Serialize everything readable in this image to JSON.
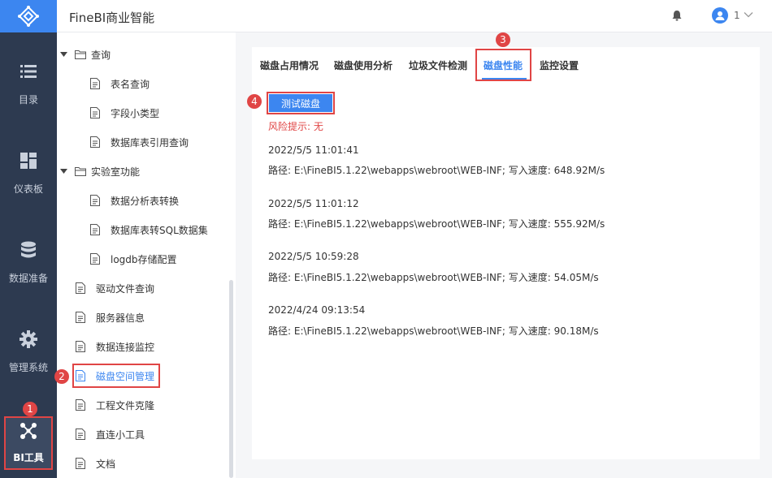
{
  "header": {
    "app_title": "FineBI商业智能",
    "user_name": "1"
  },
  "leftnav": {
    "items": [
      {
        "label": "目录",
        "icon": "list-icon"
      },
      {
        "label": "仪表板",
        "icon": "dashboard-icon"
      },
      {
        "label": "数据准备",
        "icon": "database-icon"
      },
      {
        "label": "管理系统",
        "icon": "gear-icon"
      },
      {
        "label": "BI工具",
        "icon": "bi-tools-icon",
        "selected": true
      }
    ]
  },
  "tree": {
    "items": [
      {
        "label": "查询",
        "type": "folder"
      },
      {
        "label": "表名查询",
        "type": "doc"
      },
      {
        "label": "字段小类型",
        "type": "doc"
      },
      {
        "label": "数据库表引用查询",
        "type": "doc"
      },
      {
        "label": "实验室功能",
        "type": "folder"
      },
      {
        "label": "数据分析表转换",
        "type": "doc"
      },
      {
        "label": "数据库表转SQL数据集",
        "type": "doc"
      },
      {
        "label": "logdb存储配置",
        "type": "doc"
      },
      {
        "label": "驱动文件查询",
        "type": "doc"
      },
      {
        "label": "服务器信息",
        "type": "doc"
      },
      {
        "label": "数据连接监控",
        "type": "doc"
      },
      {
        "label": "磁盘空间管理",
        "type": "doc",
        "active": true
      },
      {
        "label": "工程文件克隆",
        "type": "doc"
      },
      {
        "label": "直连小工具",
        "type": "doc"
      },
      {
        "label": "文档",
        "type": "doc"
      }
    ]
  },
  "tabs": [
    {
      "label": "磁盘占用情况"
    },
    {
      "label": "磁盘使用分析"
    },
    {
      "label": "垃圾文件检测"
    },
    {
      "label": "磁盘性能",
      "selected": true
    },
    {
      "label": "监控设置"
    }
  ],
  "content": {
    "test_button_label": "测试磁盘",
    "risk_text": "风险提示: 无",
    "records": [
      {
        "time": "2022/5/5 11:01:41",
        "detail": "路径: E:\\FineBI5.1.22\\webapps\\webroot\\WEB-INF; 写入速度: 648.92M/s"
      },
      {
        "time": "2022/5/5 11:01:12",
        "detail": "路径: E:\\FineBI5.1.22\\webapps\\webroot\\WEB-INF; 写入速度: 555.92M/s"
      },
      {
        "time": "2022/5/5 10:59:28",
        "detail": "路径: E:\\FineBI5.1.22\\webapps\\webroot\\WEB-INF; 写入速度: 54.05M/s"
      },
      {
        "time": "2022/4/24 09:13:54",
        "detail": "路径: E:\\FineBI5.1.22\\webapps\\webroot\\WEB-INF; 写入速度: 90.18M/s"
      }
    ]
  },
  "badges": [
    "1",
    "2",
    "3",
    "4"
  ],
  "colors": {
    "accent": "#3c86f0",
    "nav_bg": "#2d3a50",
    "highlight": "#e04545"
  }
}
